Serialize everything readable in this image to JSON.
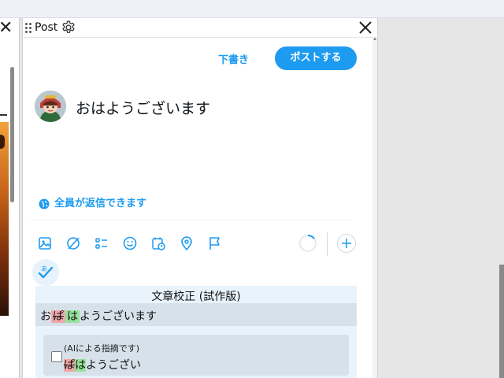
{
  "left_column": {
    "close_glyph": "✕",
    "divider_glyph": "—"
  },
  "panel": {
    "title": "Post",
    "draft_label": "下書き",
    "post_button": "ポストする",
    "tweet_text": "おはようございます",
    "reply_setting": "全員が返信できます",
    "toolbar_icons": [
      "media-icon",
      "gif-icon",
      "poll-icon",
      "emoji-icon",
      "schedule-icon",
      "location-icon",
      "flag-icon"
    ],
    "add_glyph": "+"
  },
  "proofread": {
    "title": "文章校正 (試作版)",
    "line_before": "お",
    "line_deleted": "ぱ",
    "line_inserted": "は",
    "line_after": "ようございます",
    "suggestion_note": "(AIによる指摘です)",
    "suggestion_deleted": "ぱ",
    "suggestion_inserted": "は",
    "suggestion_after": "ようござい"
  },
  "colors": {
    "accent": "#1d9bf0",
    "deleted_bg": "#f2a7a9",
    "inserted_bg": "#95e39a"
  }
}
